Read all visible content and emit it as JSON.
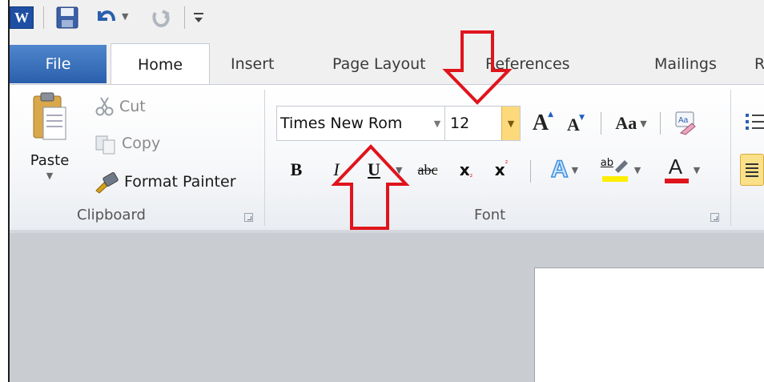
{
  "quick_access": {
    "app_icon_letter": "W",
    "icons": [
      "word-app-icon",
      "save-icon",
      "undo-icon",
      "redo-icon",
      "customize-qat-icon"
    ]
  },
  "tabs": {
    "file": "File",
    "home": "Home",
    "insert": "Insert",
    "page_layout": "Page Layout",
    "references": "References",
    "mailings": "Mailings",
    "review_partial": "R"
  },
  "clipboard": {
    "paste": "Paste",
    "cut": "Cut",
    "copy": "Copy",
    "format_painter": "Format Painter",
    "group_label": "Clipboard"
  },
  "font": {
    "font_name": "Times New Rom",
    "font_size": "12",
    "group_label": "Font",
    "bold": "B",
    "italic": "I",
    "underline": "U",
    "strikethrough": "abc",
    "subscript": "x",
    "superscript": "x",
    "grow": "A",
    "shrink": "A",
    "change_case": "Aa",
    "font_color": "A",
    "highlight": "ab"
  },
  "annotations": {
    "arrow_color": "#e0141c"
  },
  "colors": {
    "file_tab": "#2b5fad",
    "highlight_yellow": "#ffee00",
    "font_red": "#e0141c",
    "text_effect_blue": "#3b8fe0"
  }
}
